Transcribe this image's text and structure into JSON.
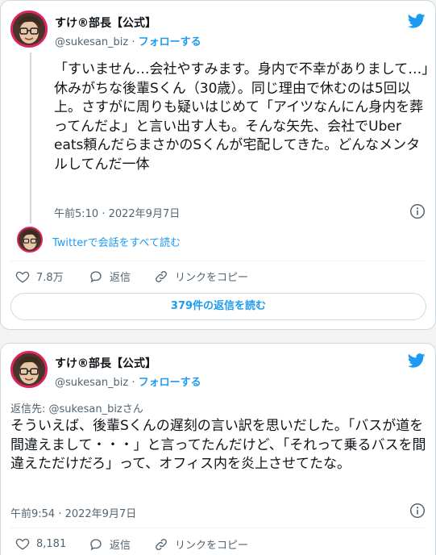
{
  "colors": {
    "accent": "#1d9bf0",
    "avatar_ring": "#e0245e",
    "muted": "#536471"
  },
  "tweets": [
    {
      "author_name": "すけ®部長【公式】",
      "handle": "@sukesan_biz",
      "separator": "·",
      "follow_label": "フォローする",
      "text": "「すいません…会社やすみます。身内で不幸がありまして…」休みがちな後輩Sくん（30歳）。同じ理由で休むのは5回以上。さすがに周りも疑いはじめて「アイツなんにん身内を葬ってんだよ」と言い出す人も。そんな矢先、会社でUber eats頼んだらまさかのSくんが宅配してきた。どんなメンタルしてんだ一体",
      "timestamp": "午前5:10 · 2022年9月7日",
      "thread_link": "Twitterで会話をすべて読む",
      "likes": "7.8万",
      "reply_label": "返信",
      "copy_label": "リンクをコピー",
      "replies_button": "379件の返信を読む"
    },
    {
      "author_name": "すけ®部長【公式】",
      "handle": "@sukesan_biz",
      "separator": "·",
      "follow_label": "フォローする",
      "reply_to": "返信先: @sukesan_bizさん",
      "text": "そういえば、後輩Sくんの遅刻の言い訳を思いだした。「バスが道を間違えまして・・・」と言ってたんだけど、「それって乗るバスを間違えただけだろ」って、オフィス内を炎上させてたな。",
      "timestamp": "午前9:54 · 2022年9月7日",
      "likes": "8,181",
      "reply_label": "返信",
      "copy_label": "リンクをコピー"
    }
  ],
  "icons": [
    "avatar",
    "twitter-bird-icon",
    "info-icon",
    "heart-icon",
    "reply-icon",
    "link-icon"
  ]
}
